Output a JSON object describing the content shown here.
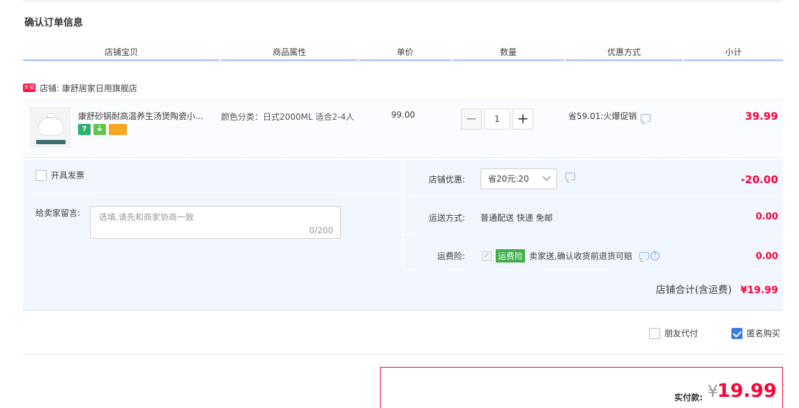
{
  "page": {
    "title": "确认订单信息"
  },
  "columns": [
    "店铺宝贝",
    "商品属性",
    "单价",
    "数量",
    "优惠方式",
    "小计"
  ],
  "shop": {
    "badge": "天猫",
    "label": "店铺: 康舒居家日用旗舰店"
  },
  "item": {
    "title": "康舒砂锅耐高温养生汤煲陶瓷小...",
    "attr": "颜色分类：日式2000ML 适合2-4人",
    "price": "99.00",
    "quantity": "1",
    "minus": "−",
    "plus": "+",
    "promo": "省59.01:火爆促销",
    "subtotal": "39.99",
    "service_icons": [
      {
        "name": "seven-day-return-icon",
        "glyph": "7",
        "color": "#29b06b"
      },
      {
        "name": "plug-service-icon",
        "glyph": "⏚",
        "color": "#65c14b"
      },
      {
        "name": "credit-card-icon",
        "glyph": "",
        "color": "#f6a623"
      }
    ]
  },
  "options": {
    "invoice_label": "开具发票",
    "message_label": "给卖家留言:",
    "message_placeholder": "选填,请先和商家协商一致",
    "message_count": "0/200",
    "shop_discount_label": "店铺优惠:",
    "shop_discount_selected": "省20元:20",
    "shop_discount_value": "-20.00",
    "shipping_label": "运送方式:",
    "shipping_value": "普通配送 快递 免邮",
    "shipping_cost": "0.00",
    "insurance_label": "运费险:",
    "insurance_tag": "运费险",
    "insurance_text": "卖家送,确认收货前退货可赔",
    "insurance_cost": "0.00",
    "shop_total_label": "店铺合计(含运费)",
    "shop_total_value": "¥19.99"
  },
  "extras": {
    "friend_pay": "朋友代付",
    "anonymous": "匿名购买"
  },
  "payment": {
    "label": "实付款:",
    "currency": "¥",
    "amount": "19.99"
  },
  "colors": {
    "accent": "#ff0036",
    "header_border": "#b2d1ff",
    "panel_bg": "#f2f7ff",
    "checkbox_on": "#3b7ae0"
  }
}
